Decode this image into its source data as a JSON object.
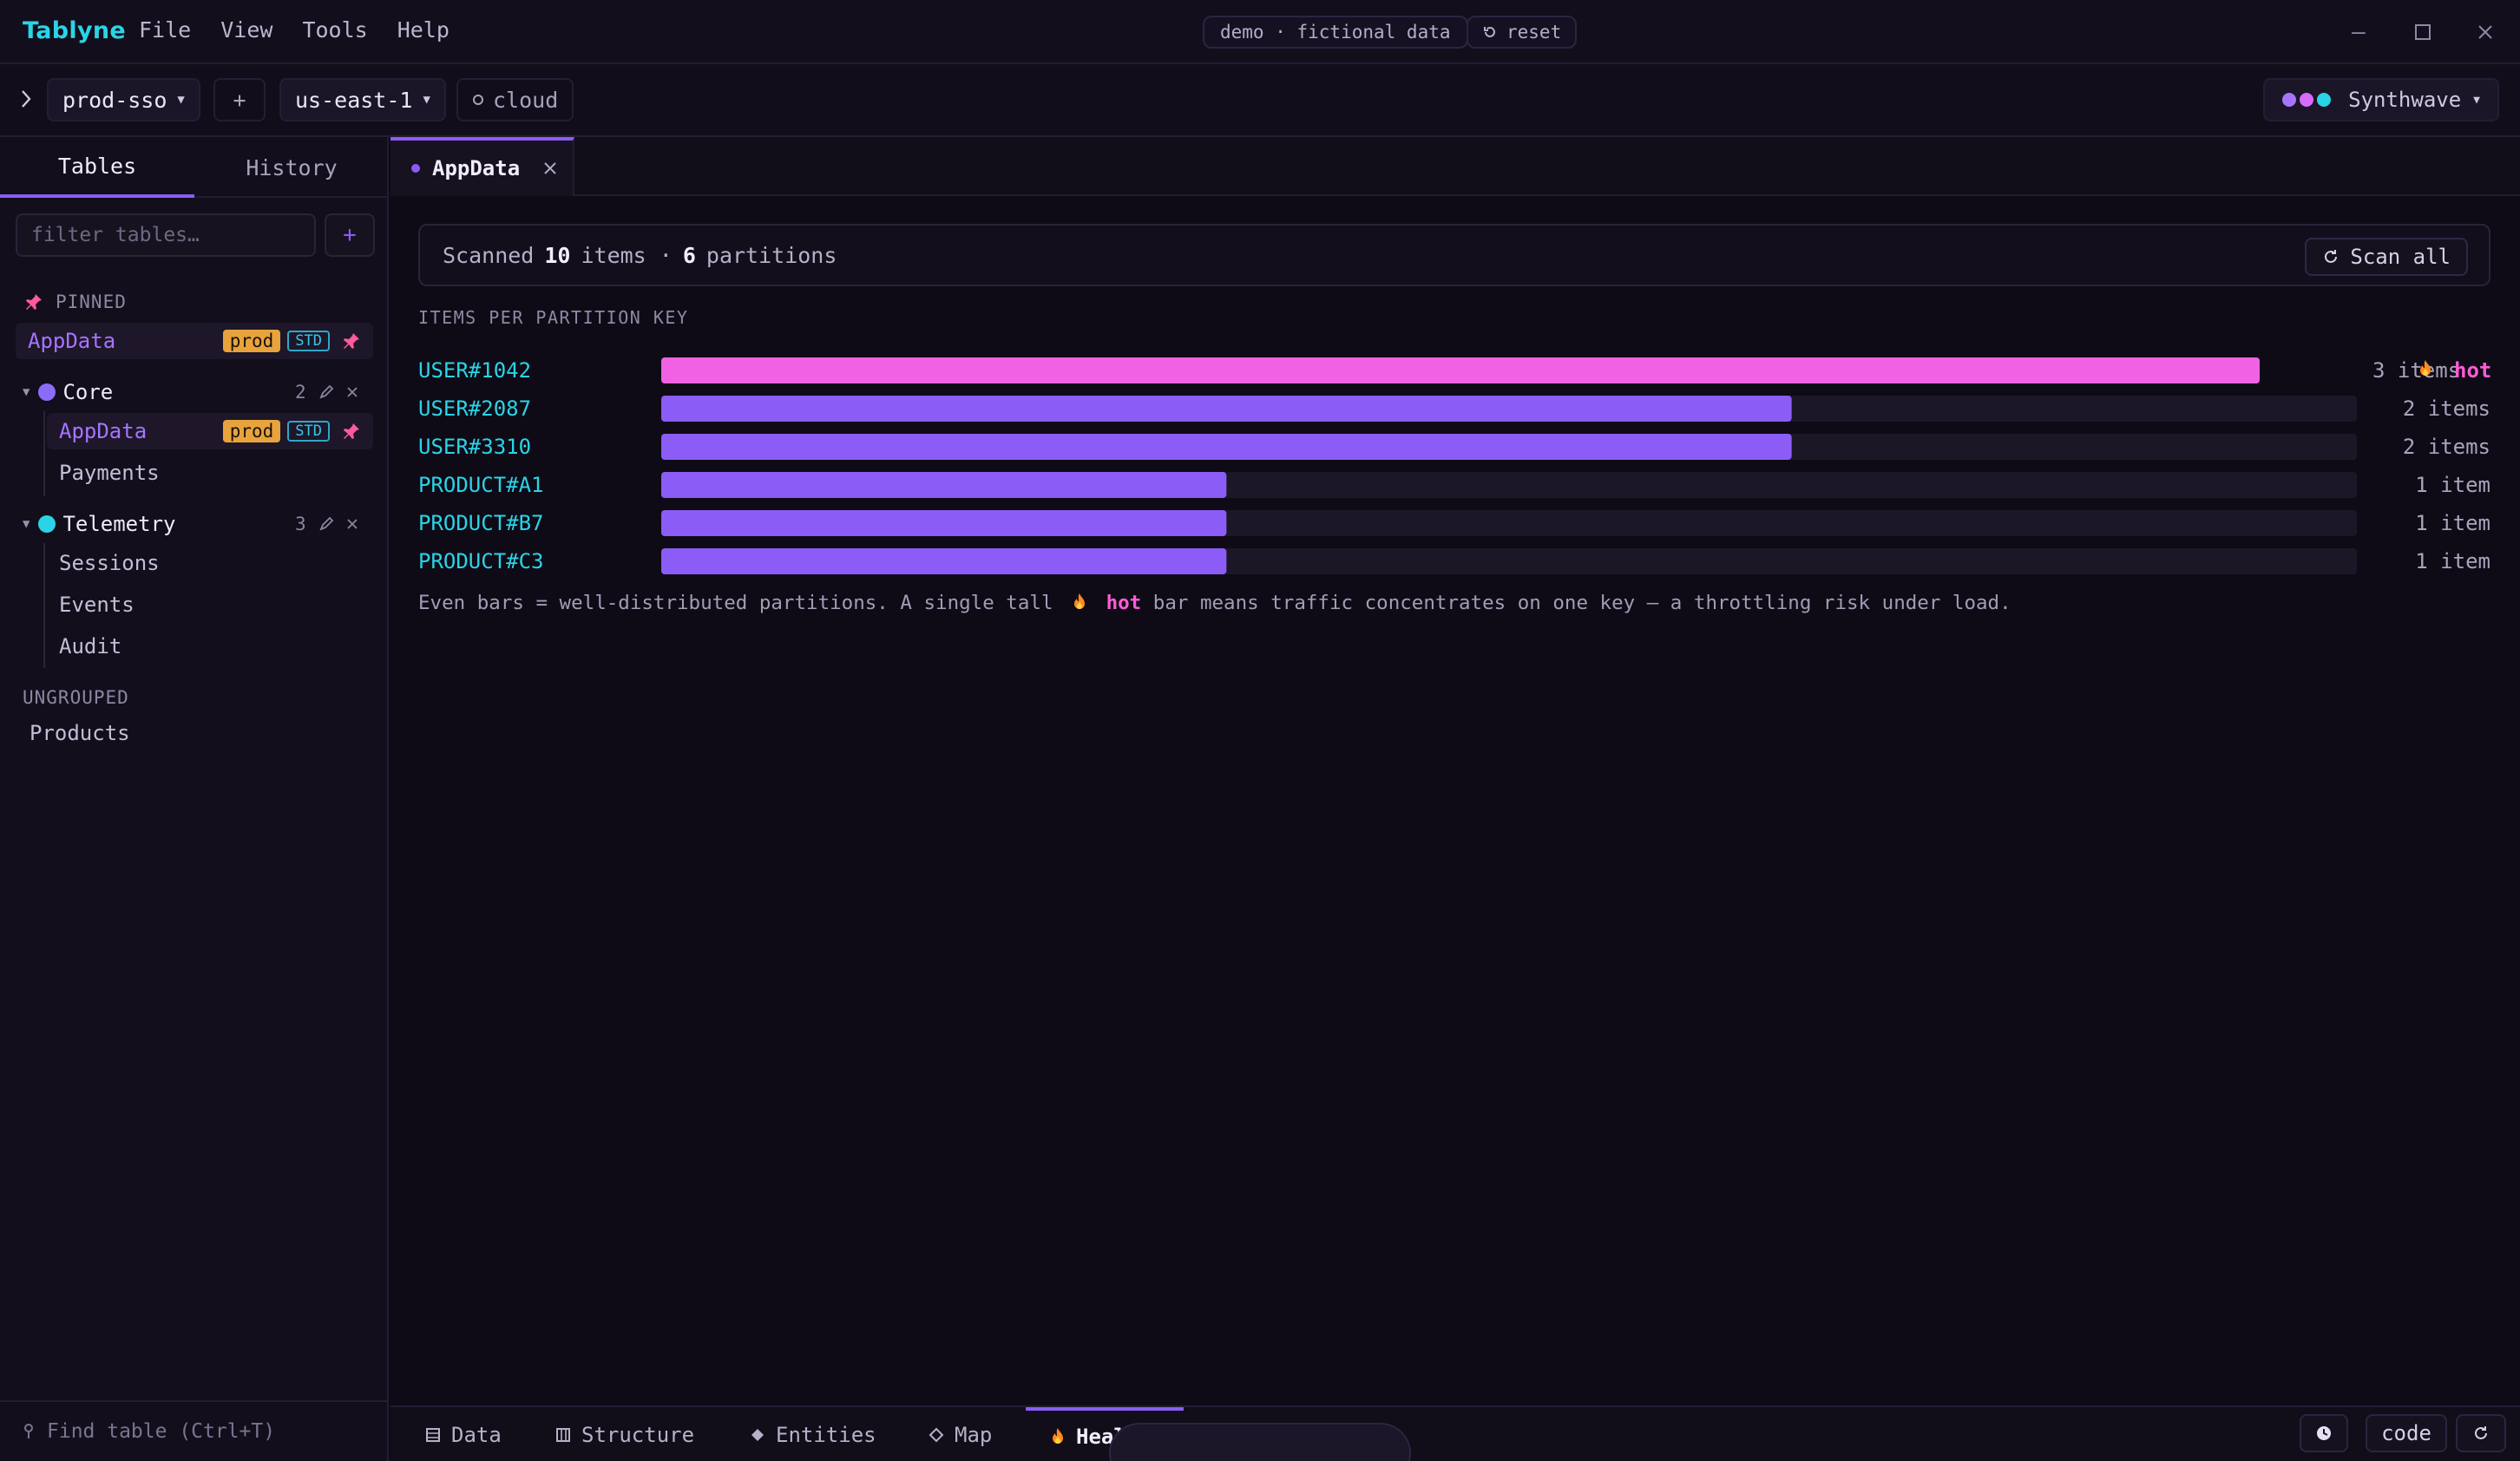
{
  "app": {
    "brand": "Tablyne",
    "menu": [
      "File",
      "View",
      "Tools",
      "Help"
    ],
    "demo_label": "demo · fictional data",
    "reset_label": "reset"
  },
  "connection": {
    "profile": "prod-sso",
    "add_label": "+",
    "region": "us-east-1",
    "mode": "cloud",
    "theme": "Synthwave",
    "theme_dots": [
      "#a774ff",
      "#d86bff",
      "#2ad4e6"
    ]
  },
  "sidebar": {
    "tabs": [
      "Tables",
      "History"
    ],
    "filter_placeholder": "filter tables…",
    "add_label": "+",
    "pinned_label": "PINNED",
    "pinned": [
      {
        "name": "AppData",
        "env": "prod",
        "class": "STD"
      }
    ],
    "groups": [
      {
        "name": "Core",
        "count": "2",
        "color": "#8b6cf6",
        "items": [
          {
            "name": "AppData",
            "env": "prod",
            "class": "STD",
            "selected": true
          },
          {
            "name": "Payments"
          }
        ]
      },
      {
        "name": "Telemetry",
        "count": "3",
        "color": "#2ad4e6",
        "items": [
          {
            "name": "Sessions"
          },
          {
            "name": "Events"
          },
          {
            "name": "Audit"
          }
        ]
      }
    ],
    "ungrouped_label": "UNGROUPED",
    "ungrouped": [
      "Products"
    ],
    "find_placeholder": "Find table (Ctrl+T)"
  },
  "tabs": {
    "active": "AppData"
  },
  "scan": {
    "prefix": "Scanned",
    "items": "10",
    "items_word": "items ·",
    "partitions": "6",
    "partitions_word": "partitions",
    "button": "Scan all"
  },
  "chart_data": {
    "type": "bar",
    "orientation": "horizontal",
    "title": "ITEMS PER PARTITION KEY",
    "categories": [
      "USER#1042",
      "USER#2087",
      "USER#3310",
      "PRODUCT#A1",
      "PRODUCT#B7",
      "PRODUCT#C3"
    ],
    "values": [
      3,
      2,
      2,
      1,
      1,
      1
    ],
    "value_labels": [
      "3 items",
      "2 items",
      "2 items",
      "1 item",
      "1 item",
      "1 item"
    ],
    "hot_index": 0,
    "hot_label": "hot",
    "xlim": [
      0,
      3
    ],
    "colors": {
      "normal": "#8b5cf6",
      "hot": "#f062e3",
      "track": "#1c1727",
      "label": "#2ad4e6"
    }
  },
  "note": {
    "before": "Even bars = well-distributed partitions. A single tall",
    "hot": "hot",
    "after": "bar means traffic concentrates on one key — a throttling risk under load."
  },
  "bottom_tabs": [
    "Data",
    "Structure",
    "Entities",
    "Map",
    "Health"
  ],
  "bottom_right": {
    "code_label": "code"
  }
}
